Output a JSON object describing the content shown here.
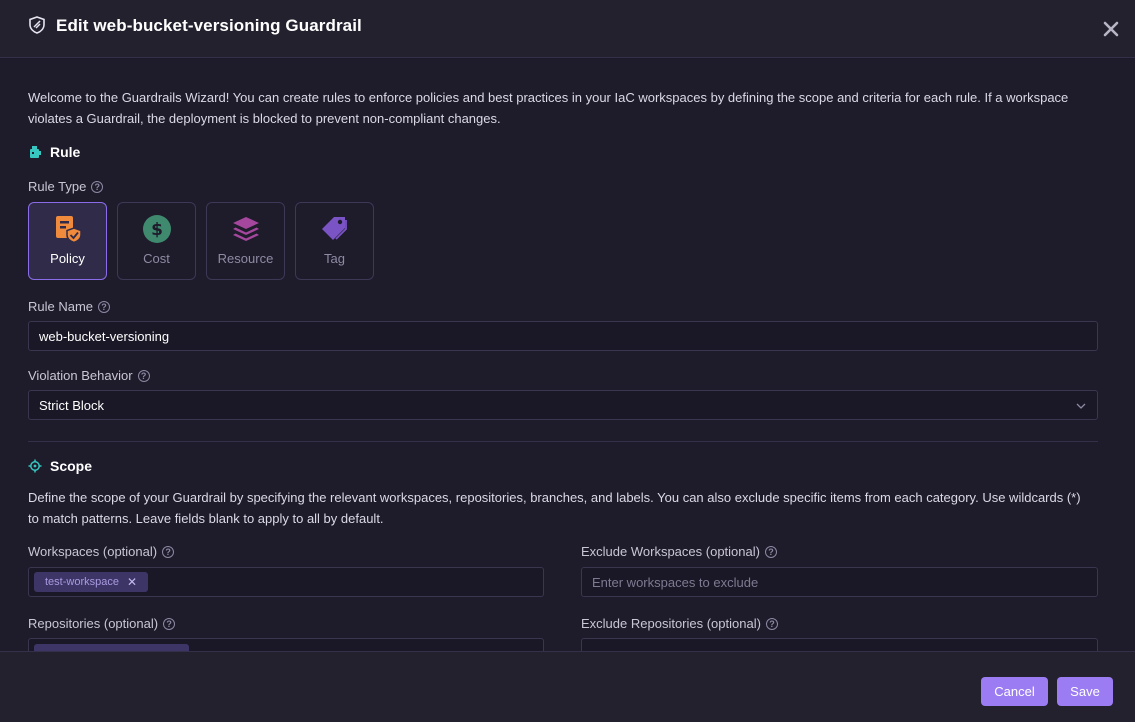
{
  "modal": {
    "title": "Edit web-bucket-versioning Guardrail",
    "intro": "Welcome to the Guardrails Wizard! You can create rules to enforce policies and best practices in your IaC workspaces by defining the scope and criteria for each rule. If a workspace violates a Guardrail, the deployment is blocked to prevent non-compliant changes."
  },
  "rule": {
    "heading": "Rule",
    "type_label": "Rule Type",
    "types": [
      {
        "label": "Policy",
        "icon": "policy-icon",
        "selected": true
      },
      {
        "label": "Cost",
        "icon": "dollar-icon",
        "selected": false
      },
      {
        "label": "Resource",
        "icon": "layers-icon",
        "selected": false
      },
      {
        "label": "Tag",
        "icon": "tag-icon",
        "selected": false
      }
    ],
    "name_label": "Rule Name",
    "name_value": "web-bucket-versioning",
    "violation_label": "Violation Behavior",
    "violation_value": "Strict Block"
  },
  "scope": {
    "heading": "Scope",
    "description": "Define the scope of your Guardrail by specifying the relevant workspaces, repositories, branches, and labels. You can also exclude specific items from each category. Use wildcards (*) to match patterns. Leave fields blank to apply to all by default.",
    "workspaces_label": "Workspaces (optional)",
    "workspaces_chips": [
      "test-workspace"
    ],
    "exclude_workspaces_label": "Exclude Workspaces (optional)",
    "exclude_workspaces_placeholder": "Enter workspaces to exclude",
    "repositories_label": "Repositories (optional)",
    "exclude_repositories_label": "Exclude Repositories (optional)"
  },
  "footer": {
    "cancel": "Cancel",
    "save": "Save"
  },
  "colors": {
    "accent": "#9b7cf2",
    "policy_icon": "#f08a3c",
    "cost_icon": "#3f8a6e",
    "resource_icon": "#a6479e",
    "tag_icon": "#7a53c4",
    "section_icon": "#37c7c0"
  }
}
